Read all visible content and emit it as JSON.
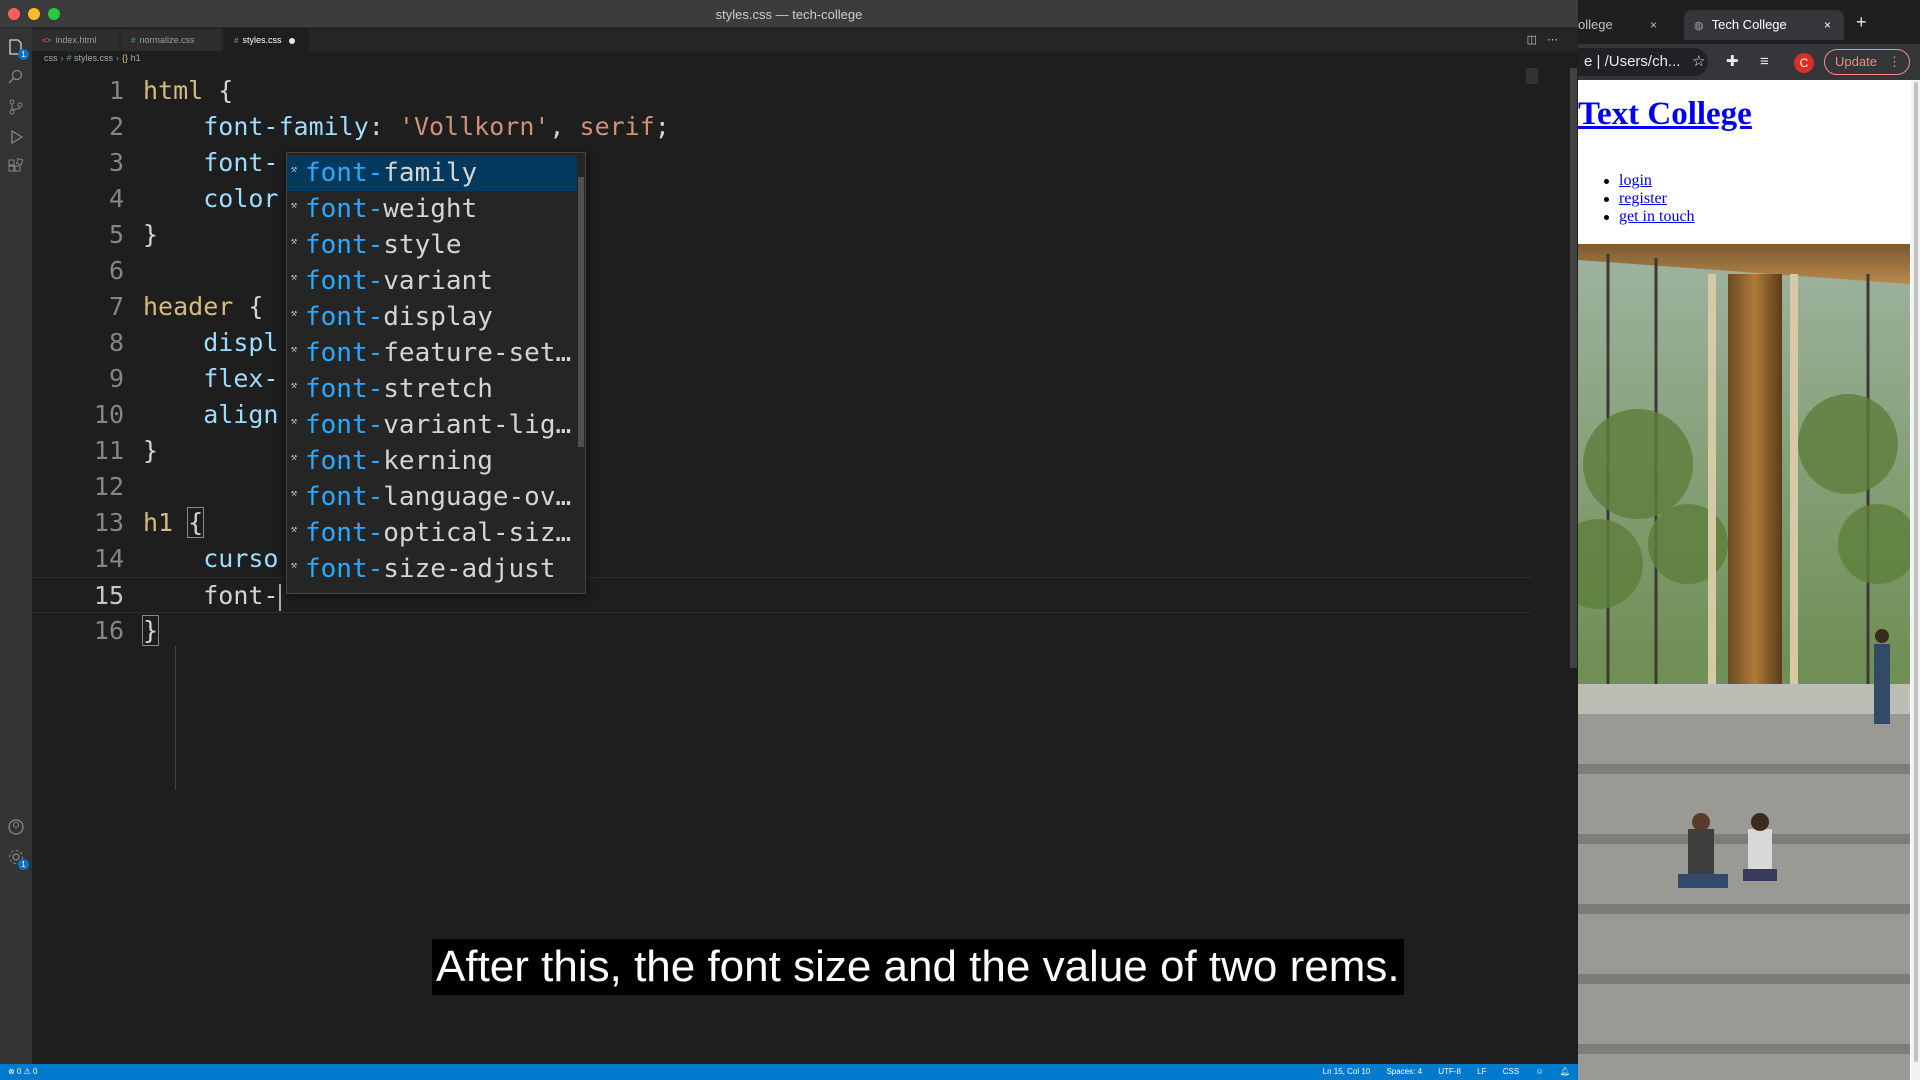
{
  "vscode": {
    "title": "styles.css — tech-college",
    "tabs": [
      {
        "icon": "<>",
        "label": "index.html",
        "active": false
      },
      {
        "icon": "#",
        "label": "normalize.css",
        "active": false
      },
      {
        "icon": "#",
        "label": "styles.css",
        "active": true,
        "modified": true
      }
    ],
    "breadcrumb": [
      "css",
      "styles.css",
      "h1"
    ],
    "lines": [
      {
        "n": "1"
      },
      {
        "n": "2"
      },
      {
        "n": "3"
      },
      {
        "n": "4"
      },
      {
        "n": "5"
      },
      {
        "n": "6"
      },
      {
        "n": "7"
      },
      {
        "n": "8"
      },
      {
        "n": "9"
      },
      {
        "n": "10"
      },
      {
        "n": "11"
      },
      {
        "n": "12"
      },
      {
        "n": "13"
      },
      {
        "n": "14"
      },
      {
        "n": "15"
      },
      {
        "n": "16"
      }
    ],
    "code": {
      "l1_sel": "html",
      "l1_brace": " {",
      "l2_prop": "font-family",
      "l2_colon": ": ",
      "l2_str": "'Vollkorn'",
      "l2_rest": ", ",
      "l2_val": "serif",
      "l2_semi": ";",
      "l3_prop": "font-",
      "l4_prop": "color",
      "l5": "}",
      "l7_sel": "header",
      "l7_brace": " {",
      "l8_prop": "displ",
      "l9_prop": "flex-",
      "l10_prop": "align",
      "l11": "}",
      "l13_sel": "h1",
      "l13_sp": " ",
      "l13_brace": "{",
      "l14_prop": "curso",
      "l15_prop": "font-",
      "l16": "}"
    },
    "suggestions": {
      "match": "font-",
      "items": [
        {
          "rest": "family",
          "selected": true
        },
        {
          "rest": "weight"
        },
        {
          "rest": "style"
        },
        {
          "rest": "variant"
        },
        {
          "rest": "display"
        },
        {
          "rest": "feature-set…"
        },
        {
          "rest": "stretch"
        },
        {
          "rest": "variant-lig…"
        },
        {
          "rest": "kerning"
        },
        {
          "rest": "language-ov…"
        },
        {
          "rest": "optical-siz…"
        },
        {
          "rest": "size-adjust"
        }
      ]
    },
    "caption": "After this, the font size and the value of two rems.",
    "status": {
      "problems": "⊗ 0 ⚠ 0",
      "position": "Ln 15, Col 10",
      "spaces": "Spaces: 4",
      "encoding": "UTF-8",
      "eol": "LF",
      "language": "CSS"
    }
  },
  "browser": {
    "tabs": [
      {
        "label": "ollege",
        "close": "×"
      },
      {
        "label": "Tech College",
        "close": "×",
        "active": true
      }
    ],
    "new_tab": "+",
    "url": "e  |  /Users/ch...",
    "update_label": "Update",
    "avatar_letter": "C",
    "page": {
      "title": "Text College",
      "nav": [
        "login",
        "register",
        "get in touch"
      ]
    }
  },
  "colors": {
    "selector": "#d7ba7d",
    "property": "#9cdcfe",
    "string": "#ce9178",
    "match": "#2aaaff",
    "statusbar": "#007acc"
  }
}
